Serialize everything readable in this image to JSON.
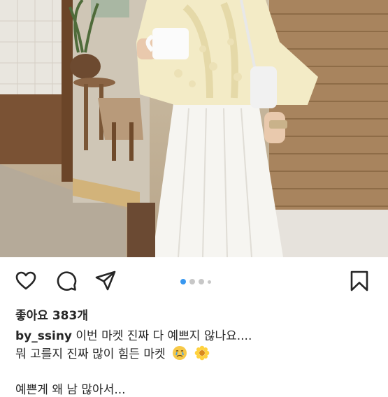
{
  "post": {
    "image_alt": "Woman in a pale yellow lace blouse and white pleated skirt holding a white mug",
    "likes_text": "좋아요 383개",
    "username": "by_ssiny",
    "caption_line1": " 이번 마켓 진짜 다 예쁘지 않나요....",
    "caption_line2": "뭐 고를지 진짜 많이 힘든 마켓",
    "caption_line3": "예쁜게 왜 남 많아서..."
  },
  "actions": [
    "heart-icon",
    "comment-icon",
    "share-icon",
    "bookmark-icon"
  ],
  "carousel": {
    "count": 4,
    "active_index": 0
  },
  "colors": {
    "accent": "#3897f0",
    "text": "#262626",
    "dot": "#c7c7c7"
  }
}
